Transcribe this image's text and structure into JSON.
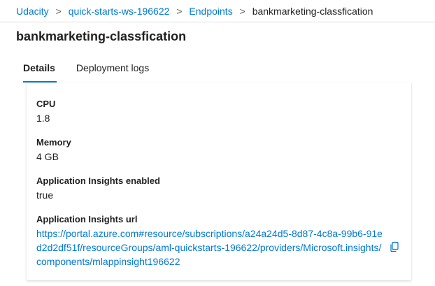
{
  "breadcrumb": {
    "items": [
      "Udacity",
      "quick-starts-ws-196622",
      "Endpoints"
    ],
    "current": "bankmarketing-classfication",
    "separator": ">"
  },
  "page_title": "bankmarketing-classfication",
  "tabs": [
    {
      "label": "Details",
      "active": true
    },
    {
      "label": "Deployment logs",
      "active": false
    }
  ],
  "details": {
    "partial_value": "--",
    "cpu": {
      "label": "CPU",
      "value": "1.8"
    },
    "memory": {
      "label": "Memory",
      "value": "4 GB"
    },
    "app_insights_enabled": {
      "label": "Application Insights enabled",
      "value": "true"
    },
    "app_insights_url": {
      "label": "Application Insights url",
      "value": "https://portal.azure.com#resource/subscriptions/a24a24d5-8d87-4c8a-99b6-91ed2d2df51f/resourceGroups/aml-quickstarts-196622/providers/Microsoft.insights/components/mlappinsight196622"
    }
  },
  "colors": {
    "accent": "#0078d4",
    "text": "#201f1e"
  },
  "icons": {
    "copy": "copy-icon"
  }
}
